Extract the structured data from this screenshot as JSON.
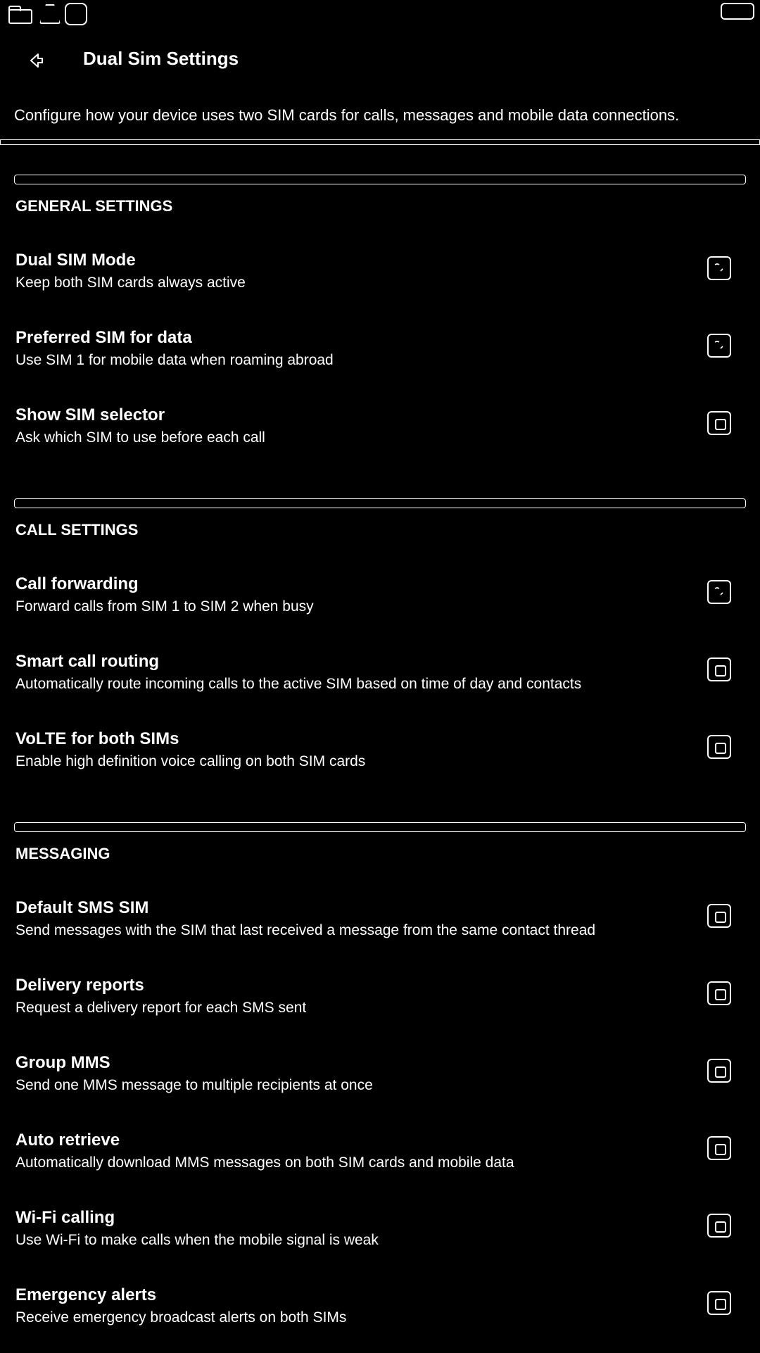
{
  "status_bar": {
    "icons": [
      "folder-icon",
      "warning-triangle-icon",
      "square-app-icon",
      "battery-icon"
    ]
  },
  "header": {
    "title": "Dual Sim Settings",
    "back_icon": "back-arrow-icon"
  },
  "description": "Configure how your device uses two SIM cards for calls, messages and mobile data connections.",
  "sections": [
    {
      "header": "GENERAL SETTINGS",
      "items": [
        {
          "title": "Dual SIM Mode",
          "summary": "Keep both SIM cards always active",
          "checked": true
        },
        {
          "title": "Preferred SIM for data",
          "summary": "Use SIM 1 for mobile data when roaming abroad",
          "checked": true
        },
        {
          "title": "Show SIM selector",
          "summary": "Ask which SIM to use before each call",
          "checked": false
        }
      ]
    },
    {
      "header": "CALL SETTINGS",
      "items": [
        {
          "title": "Call forwarding",
          "summary": "Forward calls from SIM 1 to SIM 2 when busy",
          "checked": true
        },
        {
          "title": "Smart call routing",
          "summary": "Automatically route incoming calls to the active SIM based on time of day and contacts",
          "checked": false
        },
        {
          "title": "VoLTE for both SIMs",
          "summary": "Enable high definition voice calling on both SIM cards",
          "checked": false
        }
      ]
    },
    {
      "header": "MESSAGING",
      "items": [
        {
          "title": "Default SMS SIM",
          "summary": "Send messages with the SIM that last received a message from the same contact thread",
          "checked": false
        },
        {
          "title": "Delivery reports",
          "summary": "Request a delivery report for each SMS sent",
          "checked": false
        },
        {
          "title": "Group MMS",
          "summary": "Send one MMS message to multiple recipients at once",
          "checked": false
        },
        {
          "title": "Auto retrieve",
          "summary": "Automatically download MMS messages on both SIM cards and mobile data",
          "checked": false
        },
        {
          "title": "Wi-Fi calling",
          "summary": "Use Wi-Fi to make calls when the mobile signal is weak",
          "checked": false
        },
        {
          "title": "Emergency alerts",
          "summary": "Receive emergency broadcast alerts on both SIMs",
          "checked": false
        }
      ]
    }
  ]
}
